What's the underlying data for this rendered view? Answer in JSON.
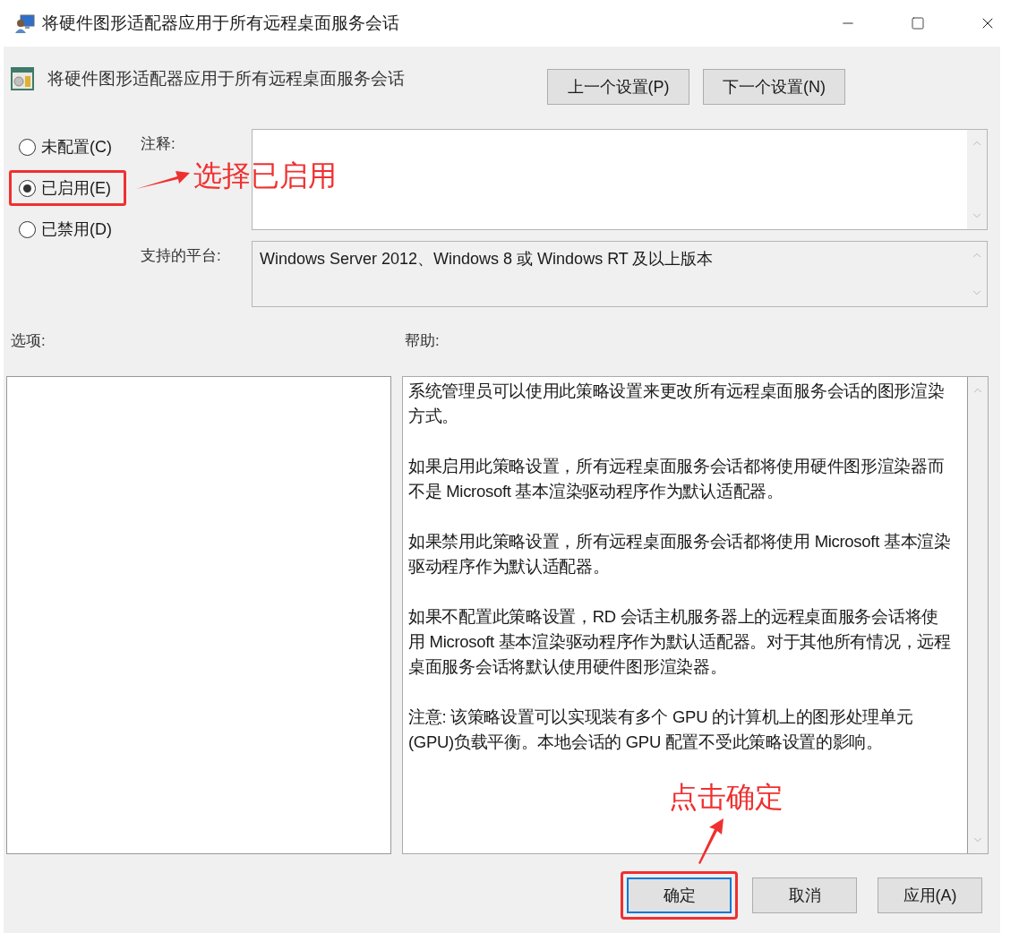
{
  "window": {
    "title": "将硬件图形适配器应用于所有远程桌面服务会话"
  },
  "policy": {
    "name": "将硬件图形适配器应用于所有远程桌面服务会话"
  },
  "nav_buttons": [
    "上一个设置(P)",
    "下一个设置(N)"
  ],
  "state_options": [
    {
      "label": "未配置(C)",
      "selected": false,
      "highlighted": false
    },
    {
      "label": "已启用(E)",
      "selected": true,
      "highlighted": true
    },
    {
      "label": "已禁用(D)",
      "selected": false,
      "highlighted": false
    }
  ],
  "comment": {
    "label": "注释:"
  },
  "platform": {
    "label": "支持的平台:",
    "value": "Windows Server 2012、Windows 8 或 Windows RT 及以上版本"
  },
  "options": {
    "label": "选项:"
  },
  "help": {
    "label": "帮助:",
    "paragraphs": [
      "系统管理员可以使用此策略设置来更改所有远程桌面服务会话的图形渲染方式。",
      "如果启用此策略设置，所有远程桌面服务会话都将使用硬件图形渲染器而不是 Microsoft 基本渲染驱动程序作为默认适配器。",
      "如果禁用此策略设置，所有远程桌面服务会话都将使用 Microsoft 基本渲染驱动程序作为默认适配器。",
      "如果不配置此策略设置，RD 会话主机服务器上的远程桌面服务会话将使用 Microsoft 基本渲染驱动程序作为默认适配器。对于其他所有情况，远程桌面服务会话将默认使用硬件图形渲染器。",
      "注意: 该策略设置可以实现装有多个 GPU 的计算机上的图形处理单元(GPU)负载平衡。本地会话的 GPU 配置不受此策略设置的影响。"
    ]
  },
  "buttons": [
    {
      "label": "确定",
      "default": true,
      "highlighted": true
    },
    {
      "label": "取消",
      "default": false,
      "highlighted": false
    },
    {
      "label": "应用(A)",
      "default": false,
      "highlighted": false
    }
  ],
  "annotations": [
    {
      "text": "选择已启用"
    },
    {
      "text": "点击确定"
    }
  ]
}
